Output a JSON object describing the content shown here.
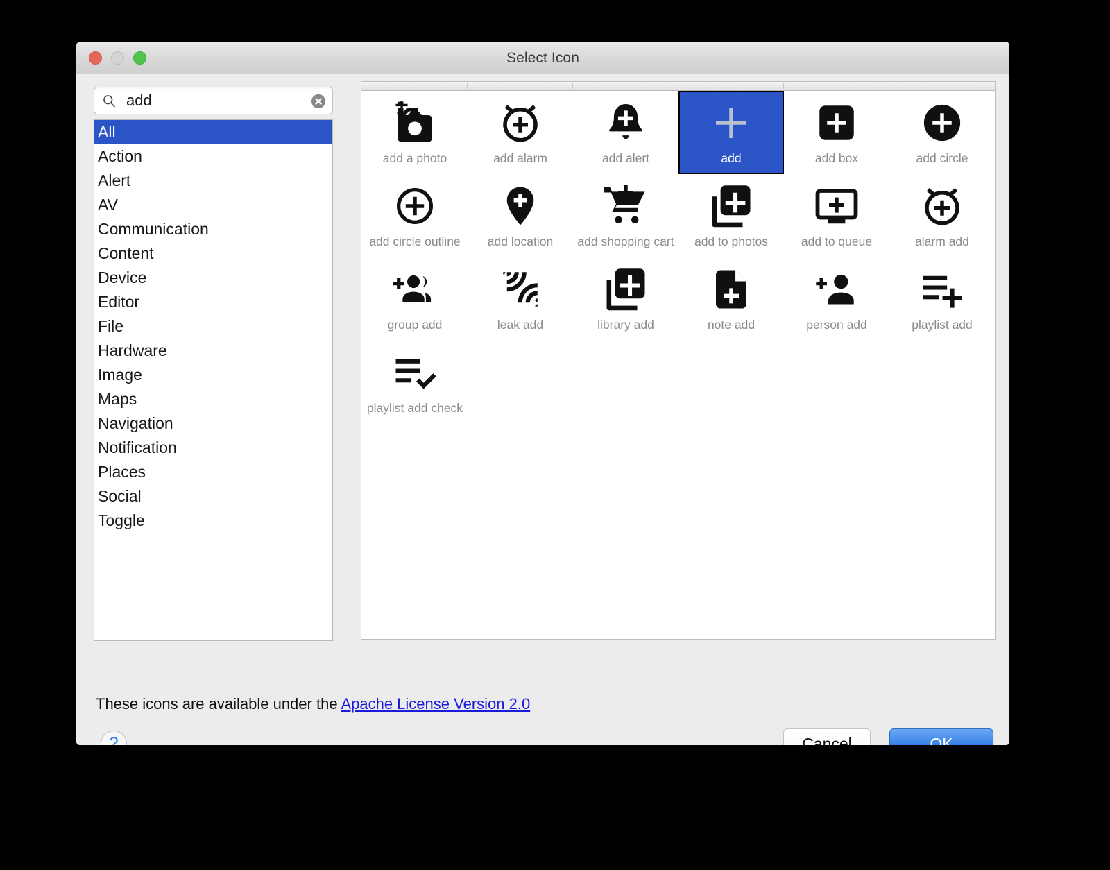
{
  "window": {
    "title": "Select Icon",
    "traffic_lights": {
      "close": "close",
      "minimize": "minimize",
      "zoom": "zoom"
    }
  },
  "search": {
    "value": "add",
    "placeholder": "",
    "search_icon": "search-icon",
    "clear_icon": "clear-icon"
  },
  "categories": {
    "selected": "All",
    "items": [
      {
        "label": "All",
        "selected": true
      },
      {
        "label": "Action",
        "selected": false
      },
      {
        "label": "Alert",
        "selected": false
      },
      {
        "label": "AV",
        "selected": false
      },
      {
        "label": "Communication",
        "selected": false
      },
      {
        "label": "Content",
        "selected": false
      },
      {
        "label": "Device",
        "selected": false
      },
      {
        "label": "Editor",
        "selected": false
      },
      {
        "label": "File",
        "selected": false
      },
      {
        "label": "Hardware",
        "selected": false
      },
      {
        "label": "Image",
        "selected": false
      },
      {
        "label": "Maps",
        "selected": false
      },
      {
        "label": "Navigation",
        "selected": false
      },
      {
        "label": "Notification",
        "selected": false
      },
      {
        "label": "Places",
        "selected": false
      },
      {
        "label": "Social",
        "selected": false
      },
      {
        "label": "Toggle",
        "selected": false
      }
    ]
  },
  "icon_grid": {
    "columns": 6,
    "selected": "add",
    "items": [
      {
        "label": "add a photo",
        "icon": "add-a-photo-icon",
        "selected": false
      },
      {
        "label": "add alarm",
        "icon": "add-alarm-icon",
        "selected": false
      },
      {
        "label": "add alert",
        "icon": "add-alert-icon",
        "selected": false
      },
      {
        "label": "add",
        "icon": "add-icon",
        "selected": true
      },
      {
        "label": "add box",
        "icon": "add-box-icon",
        "selected": false
      },
      {
        "label": "add circle",
        "icon": "add-circle-icon",
        "selected": false
      },
      {
        "label": "add circle outline",
        "icon": "add-circle-outline-icon",
        "selected": false
      },
      {
        "label": "add location",
        "icon": "add-location-icon",
        "selected": false
      },
      {
        "label": "add shopping cart",
        "icon": "add-shopping-cart-icon",
        "selected": false
      },
      {
        "label": "add to photos",
        "icon": "add-to-photos-icon",
        "selected": false
      },
      {
        "label": "add to queue",
        "icon": "add-to-queue-icon",
        "selected": false
      },
      {
        "label": "alarm add",
        "icon": "alarm-add-icon",
        "selected": false
      },
      {
        "label": "group add",
        "icon": "group-add-icon",
        "selected": false
      },
      {
        "label": "leak add",
        "icon": "leak-add-icon",
        "selected": false
      },
      {
        "label": "library add",
        "icon": "library-add-icon",
        "selected": false
      },
      {
        "label": "note add",
        "icon": "note-add-icon",
        "selected": false
      },
      {
        "label": "person add",
        "icon": "person-add-icon",
        "selected": false
      },
      {
        "label": "playlist add",
        "icon": "playlist-add-icon",
        "selected": false
      },
      {
        "label": "playlist add check",
        "icon": "playlist-add-check-icon",
        "selected": false
      }
    ]
  },
  "footer": {
    "license_prefix": "These icons are available under the ",
    "license_link": "Apache License Version 2.0",
    "help_label": "?",
    "cancel_label": "Cancel",
    "ok_label": "OK"
  },
  "colors": {
    "selection_blue": "#2b55c7",
    "ok_button_blue": "#3c84ea",
    "link_blue": "#1b1bdd",
    "window_chrome": "#ececec",
    "caption_gray": "#8a8a8a"
  }
}
